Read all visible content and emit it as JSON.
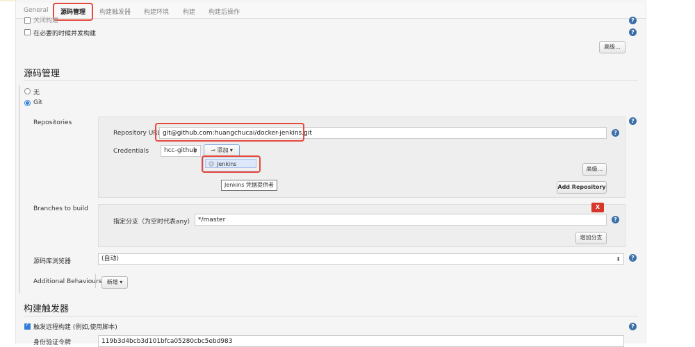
{
  "tabs": [
    "General",
    "源码管理",
    "构建触发器",
    "构建环境",
    "构建",
    "构建后操作"
  ],
  "general": {
    "cut_option": "关闭构建",
    "concurrent_option": "在必要的时候并发构建",
    "advanced_button": "高级..."
  },
  "scm": {
    "title": "源码管理",
    "radio_none": "无",
    "radio_git": "Git",
    "repositories_label": "Repositories",
    "repo_url_label": "Repository URL",
    "repo_url_value": "git@github.com:huangchucai/docker-jenkins.git",
    "credentials_label": "Credentials",
    "credentials_value": "hcc-github",
    "add_button": "添加",
    "add_menu_item": "Jenkins",
    "tooltip": "Jenkins 凭据提供者",
    "advanced_button": "高级...",
    "add_repository_button": "Add Repository",
    "branches_label": "Branches to build",
    "delete_button": "X",
    "branch_field_label": "指定分支（为空时代表any）",
    "branch_value": "*/master",
    "add_branch_button": "增加分支",
    "browser_label": "源码库浏览器",
    "browser_value": "(自动)",
    "behaviours_label": "Additional Behaviours",
    "behaviours_button": "新增"
  },
  "triggers": {
    "title": "构建触发器",
    "remote_trigger": "触发远程构建 (例如,使用脚本)",
    "token_label": "身份验证令牌",
    "token_value": "119b3d4bcb3d101bfca05280cbc5ebd983"
  },
  "colors": {
    "highlight": "#e64a3c",
    "accent": "#2f7ed8",
    "help": "#3b6fa8",
    "danger": "#d9362b"
  }
}
